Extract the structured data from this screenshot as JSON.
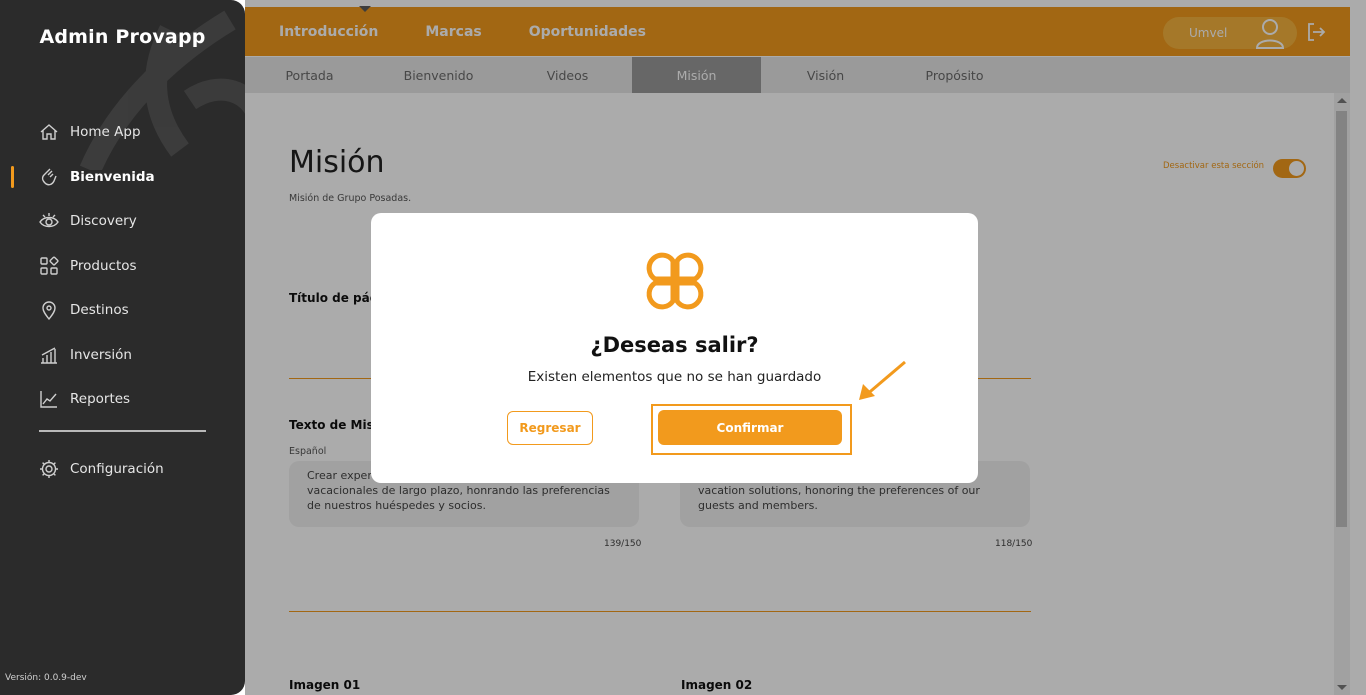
{
  "sidebar": {
    "brand": "Admin Provapp",
    "items": [
      {
        "label": "Home App",
        "icon": "home-icon"
      },
      {
        "label": "Bienvenida",
        "icon": "waving-hand-icon",
        "active": true
      },
      {
        "label": "Discovery",
        "icon": "eye-icon"
      },
      {
        "label": "Productos",
        "icon": "grid-icon"
      },
      {
        "label": "Destinos",
        "icon": "location-pin-icon"
      },
      {
        "label": "Inversión",
        "icon": "bar-chart-icon"
      },
      {
        "label": "Reportes",
        "icon": "line-chart-icon"
      }
    ],
    "config": {
      "label": "Configuración",
      "icon": "gear-icon"
    },
    "version": "Versión: 0.0.9-dev"
  },
  "topbar": {
    "tabs": [
      "Introducción",
      "Marcas",
      "Oportunidades"
    ],
    "user": "Umvel",
    "accent": "#f29a1d"
  },
  "subnav": {
    "tabs": [
      "Portada",
      "Bienvenido",
      "Videos",
      "Misión",
      "Visión",
      "Propósito"
    ],
    "active": "Misión"
  },
  "page": {
    "title": "Misión",
    "subtitle": "Misión de Grupo Posadas.",
    "toggle_label": "Desactivar esta sección",
    "title_field_label": "Título de pági",
    "text_field_label": "Texto de Misi",
    "lang_es": "Español",
    "text_es": "Crear exper\nvacacionales de largo plazo, honrando las preferencias\nde nuestros huéspedes y socios.",
    "text_en": "vacation solutions, honoring the preferences of our\nguests and members.",
    "counter_es": "139/150",
    "counter_en": "118/150",
    "image1_label": "Imagen 01",
    "image2_label": "Imagen 02"
  },
  "modal": {
    "title": "¿Deseas salir?",
    "message": "Existen elementos que no se han guardado",
    "back_label": "Regresar",
    "confirm_label": "Confirmar"
  }
}
